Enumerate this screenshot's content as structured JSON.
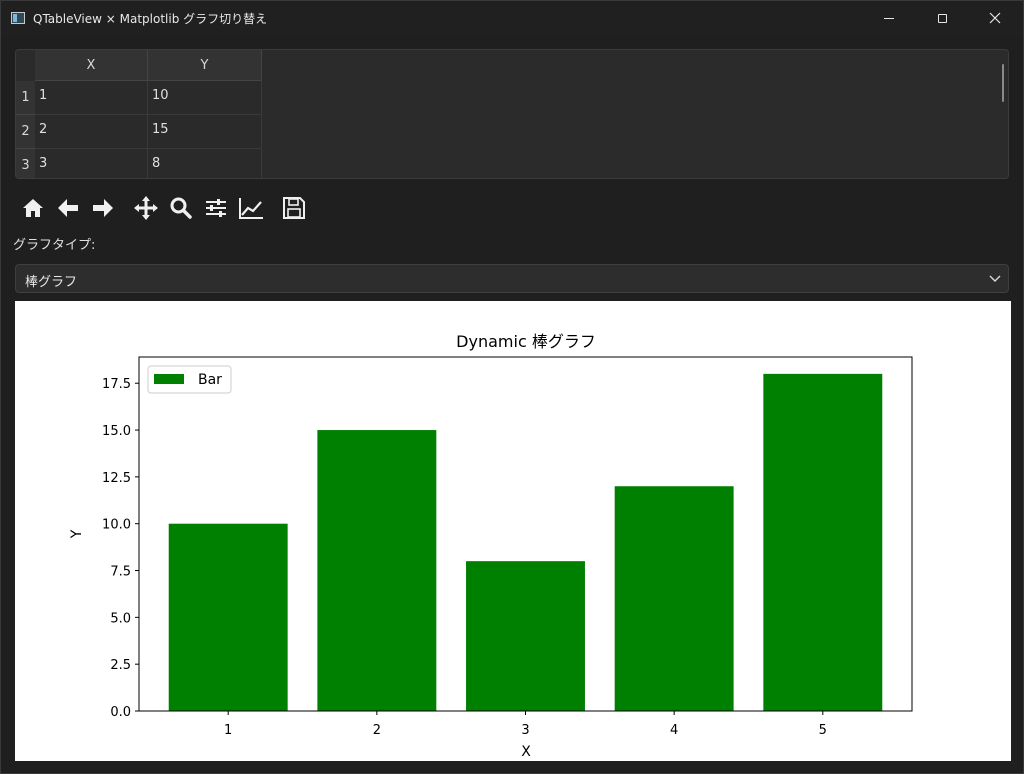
{
  "window": {
    "title": "QTableView × Matplotlib グラフ切り替え",
    "icon": "app-window-icon"
  },
  "table": {
    "columns": [
      "X",
      "Y"
    ],
    "rows": [
      {
        "header": "1",
        "x": "1",
        "y": "10"
      },
      {
        "header": "2",
        "x": "2",
        "y": "15"
      },
      {
        "header": "3",
        "x": "3",
        "y": "8"
      }
    ]
  },
  "toolbar": {
    "icons": [
      "home-icon",
      "back-arrow-icon",
      "forward-arrow-icon",
      "pan-move-icon",
      "zoom-magnifier-icon",
      "subplots-config-icon",
      "edit-axes-icon",
      "save-floppy-icon"
    ]
  },
  "graph_type": {
    "label": "グラフタイプ:",
    "selected": "棒グラフ"
  },
  "chart_data": {
    "type": "bar",
    "title": "Dynamic 棒グラフ",
    "xlabel": "X",
    "ylabel": "Y",
    "categories": [
      "1",
      "2",
      "3",
      "4",
      "5"
    ],
    "x": [
      1,
      2,
      3,
      4,
      5
    ],
    "series": [
      {
        "name": "Bar",
        "values": [
          10,
          15,
          8,
          12,
          18
        ],
        "color": "#008000"
      }
    ],
    "ylim": [
      0,
      18.9
    ],
    "yticks": [
      "0.0",
      "2.5",
      "5.0",
      "7.5",
      "10.0",
      "12.5",
      "15.0",
      "17.5"
    ],
    "legend": "top-left",
    "grid": false
  }
}
